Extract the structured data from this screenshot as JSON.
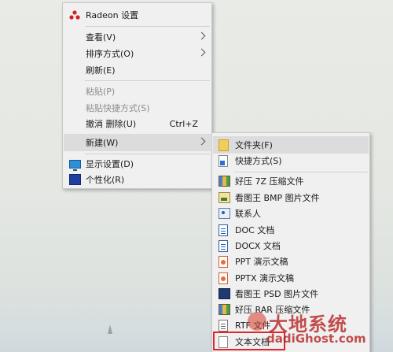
{
  "main_menu": {
    "items": [
      {
        "label": "Radeon 设置",
        "icon": "radeon-icon"
      },
      {
        "label": "查看(V)",
        "submenu": true
      },
      {
        "label": "排序方式(O)",
        "submenu": true
      },
      {
        "label": "刷新(E)"
      },
      {
        "label": "粘贴(P)",
        "disabled": true
      },
      {
        "label": "粘贴快捷方式(S)",
        "disabled": true
      },
      {
        "label": "撤消 删除(U)",
        "shortcut": "Ctrl+Z"
      },
      {
        "label": "新建(W)",
        "submenu": true,
        "highlighted": true
      },
      {
        "label": "显示设置(D)",
        "icon": "display-settings-icon"
      },
      {
        "label": "个性化(R)",
        "icon": "personalize-icon"
      }
    ]
  },
  "new_submenu": {
    "items": [
      {
        "label": "文件夹(F)",
        "icon": "folder-icon",
        "highlighted": true
      },
      {
        "label": "快捷方式(S)",
        "icon": "shortcut-icon"
      },
      {
        "label": "好压 7Z 压缩文件",
        "icon": "archive-icon"
      },
      {
        "label": "看图王 BMP 图片文件",
        "icon": "image-icon"
      },
      {
        "label": "联系人",
        "icon": "contact-icon"
      },
      {
        "label": "DOC 文档",
        "icon": "doc-icon"
      },
      {
        "label": "DOCX 文档",
        "icon": "doc-icon"
      },
      {
        "label": "PPT 演示文稿",
        "icon": "ppt-icon"
      },
      {
        "label": "PPTX 演示文稿",
        "icon": "ppt-icon"
      },
      {
        "label": "看图王 PSD 图片文件",
        "icon": "psd-icon"
      },
      {
        "label": "好压 RAR 压缩文件",
        "icon": "archive-icon"
      },
      {
        "label": "RTF 文件",
        "icon": "rtf-icon"
      },
      {
        "label": "文本文档",
        "icon": "text-file-icon",
        "boxed": true
      }
    ]
  },
  "watermark": {
    "text": "大地系统",
    "url": "dadiGhost.com"
  },
  "colors": {
    "menu_bg": "#f0f0f0",
    "highlight_bg": "#dcdcdc",
    "annotation_red": "#e0262b",
    "watermark_red": "#b51f1f"
  }
}
